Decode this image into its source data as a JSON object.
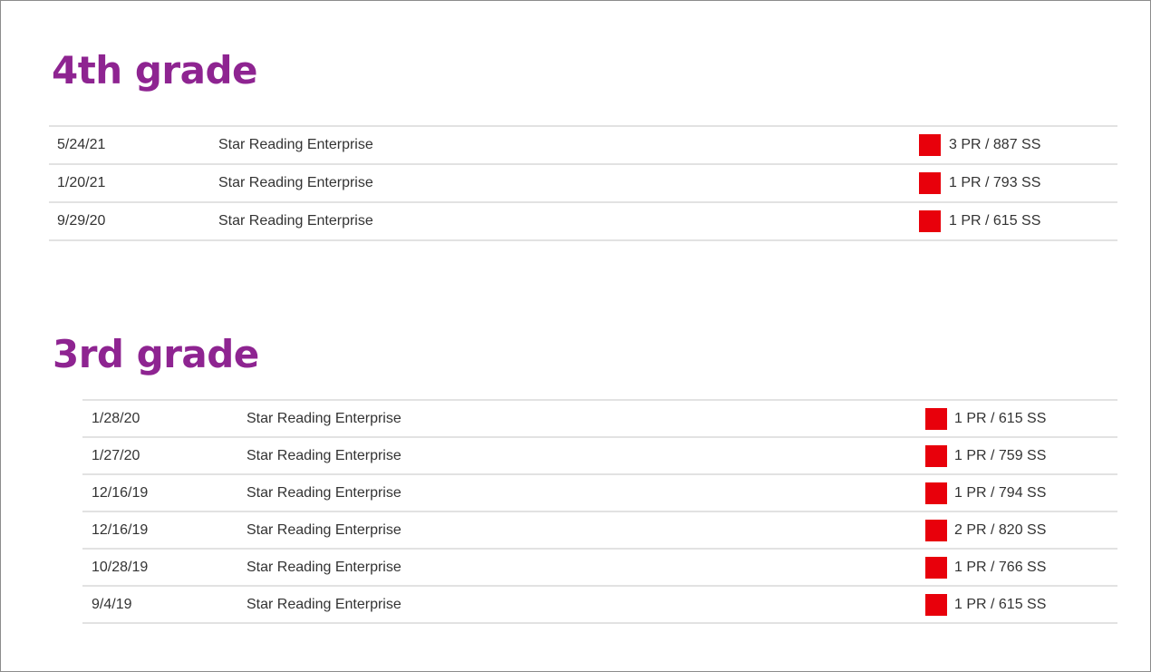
{
  "colors": {
    "heading": "#8e2491",
    "benchmark_red": "#e8000b"
  },
  "sections": [
    {
      "heading": "4th grade",
      "rows": [
        {
          "date": "5/24/21",
          "test": "Star Reading Enterprise",
          "score": "3 PR / 887 SS",
          "status_color": "red"
        },
        {
          "date": "1/20/21",
          "test": "Star Reading Enterprise",
          "score": "1 PR / 793 SS",
          "status_color": "red"
        },
        {
          "date": "9/29/20",
          "test": "Star Reading Enterprise",
          "score": "1 PR / 615 SS",
          "status_color": "red"
        }
      ]
    },
    {
      "heading": "3rd grade",
      "rows": [
        {
          "date": "1/28/20",
          "test": "Star Reading Enterprise",
          "score": "1 PR / 615 SS",
          "status_color": "red"
        },
        {
          "date": "1/27/20",
          "test": "Star Reading Enterprise",
          "score": "1 PR / 759 SS",
          "status_color": "red"
        },
        {
          "date": "12/16/19",
          "test": "Star Reading Enterprise",
          "score": "1 PR / 794 SS",
          "status_color": "red"
        },
        {
          "date": "12/16/19",
          "test": "Star Reading Enterprise",
          "score": "2 PR / 820 SS",
          "status_color": "red"
        },
        {
          "date": "10/28/19",
          "test": "Star Reading Enterprise",
          "score": "1 PR / 766 SS",
          "status_color": "red"
        },
        {
          "date": "9/4/19",
          "test": "Star Reading Enterprise",
          "score": "1 PR / 615 SS",
          "status_color": "red"
        }
      ]
    }
  ]
}
